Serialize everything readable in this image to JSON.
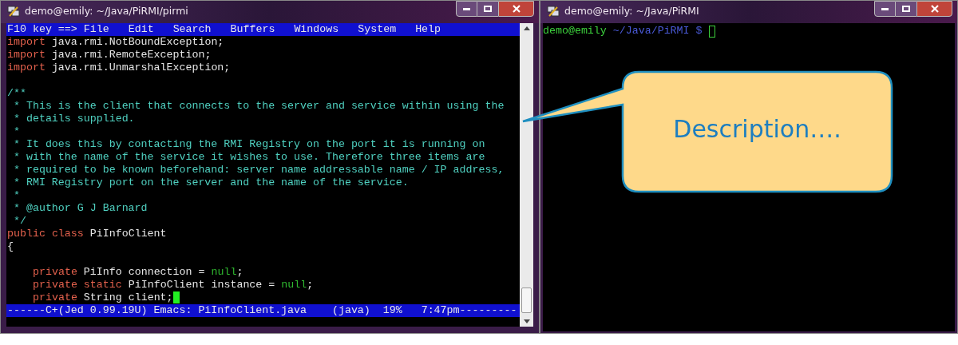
{
  "editor_window": {
    "title": "demo@emily: ~/Java/PiRMI/pirmi",
    "menu": [
      {
        "label": "F10 key ==>",
        "kind": "hint"
      },
      {
        "label": "File",
        "kind": "item"
      },
      {
        "label": "Edit",
        "kind": "item"
      },
      {
        "label": "Search",
        "kind": "item"
      },
      {
        "label": "Buffers",
        "kind": "item"
      },
      {
        "label": "Windows",
        "kind": "item"
      },
      {
        "label": "System",
        "kind": "item"
      },
      {
        "label": "Help",
        "kind": "item"
      }
    ],
    "lines": [
      {
        "kind": "code",
        "indent": false,
        "segments": [
          {
            "text": "import",
            "kind": "keyword"
          },
          {
            "text": "java.rmi.NotBoundException;",
            "kind": "plain"
          }
        ]
      },
      {
        "kind": "code",
        "indent": false,
        "segments": [
          {
            "text": "import",
            "kind": "keyword"
          },
          {
            "text": "java.rmi.RemoteException;",
            "kind": "plain"
          }
        ]
      },
      {
        "kind": "code",
        "indent": false,
        "segments": [
          {
            "text": "import",
            "kind": "keyword"
          },
          {
            "text": "java.rmi.UnmarshalException;",
            "kind": "plain"
          }
        ]
      },
      {
        "kind": "blank"
      },
      {
        "kind": "code",
        "indent": false,
        "segments": [
          {
            "text": "/**",
            "kind": "comment"
          }
        ]
      },
      {
        "kind": "code",
        "indent": false,
        "segments": [
          {
            "text": " * This is the client that connects to the server and service within using the",
            "kind": "comment"
          }
        ]
      },
      {
        "kind": "code",
        "indent": false,
        "segments": [
          {
            "text": " * details supplied.",
            "kind": "comment"
          }
        ]
      },
      {
        "kind": "code",
        "indent": false,
        "segments": [
          {
            "text": " *",
            "kind": "comment"
          }
        ]
      },
      {
        "kind": "code",
        "indent": false,
        "segments": [
          {
            "text": " * It does this by contacting the RMI Registry on the port it is running on",
            "kind": "comment"
          }
        ]
      },
      {
        "kind": "code",
        "indent": false,
        "segments": [
          {
            "text": " * with the name of the service it wishes to use. Therefore three items are",
            "kind": "comment"
          }
        ]
      },
      {
        "kind": "code",
        "indent": false,
        "segments": [
          {
            "text": " * required to be known beforehand: server name addressable name / IP address,",
            "kind": "comment"
          }
        ]
      },
      {
        "kind": "code",
        "indent": false,
        "segments": [
          {
            "text": " * RMI Registry port on the server and the name of the service.",
            "kind": "comment"
          }
        ]
      },
      {
        "kind": "code",
        "indent": false,
        "segments": [
          {
            "text": " *",
            "kind": "comment"
          }
        ]
      },
      {
        "kind": "code",
        "indent": false,
        "segments": [
          {
            "text": " * @author G J Barnard",
            "kind": "comment"
          }
        ]
      },
      {
        "kind": "code",
        "indent": false,
        "segments": [
          {
            "text": " */",
            "kind": "comment"
          }
        ]
      },
      {
        "kind": "code",
        "indent": false,
        "segments": [
          {
            "text": "public",
            "kind": "keyword"
          },
          {
            "text": "class",
            "kind": "keyword"
          },
          {
            "text": "PiInfoClient",
            "kind": "plain"
          }
        ]
      },
      {
        "kind": "code",
        "indent": false,
        "segments": [
          {
            "text": "{",
            "kind": "plain"
          }
        ]
      },
      {
        "kind": "blank"
      },
      {
        "kind": "code",
        "indent": true,
        "segments": [
          {
            "text": "private",
            "kind": "keyword"
          },
          {
            "text": "PiInfo connection =",
            "kind": "plain"
          },
          {
            "text": "null",
            "kind": "literal"
          },
          {
            "text": ";",
            "kind": "plain",
            "attached": true
          }
        ]
      },
      {
        "kind": "code",
        "indent": true,
        "segments": [
          {
            "text": "private",
            "kind": "keyword"
          },
          {
            "text": "static",
            "kind": "keyword"
          },
          {
            "text": "PiInfoClient instance =",
            "kind": "plain"
          },
          {
            "text": "null",
            "kind": "literal"
          },
          {
            "text": ";",
            "kind": "plain",
            "attached": true
          }
        ]
      },
      {
        "kind": "code",
        "indent": true,
        "segments": [
          {
            "text": "private",
            "kind": "keyword"
          },
          {
            "text": "String client;",
            "kind": "plain"
          },
          {
            "kind": "cursor",
            "attached": true
          }
        ]
      }
    ],
    "status_line": "------C+(Jed 0.99.19U) Emacs: PiInfoClient.java    (java)  19%   7:47pm---------"
  },
  "terminal_window": {
    "title": "demo@emily: ~/Java/PiRMI",
    "prompt": {
      "user": "demo@emily",
      "path": "~/Java/PiRMI",
      "symbol": "$"
    }
  },
  "callout": {
    "text": "Description…."
  }
}
